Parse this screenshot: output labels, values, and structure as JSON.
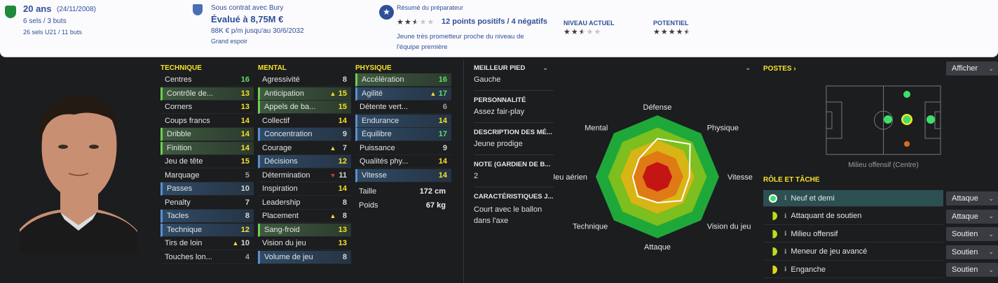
{
  "profile": {
    "age": "20 ans",
    "dob": "(24/11/2008)",
    "caps": "6 sels / 3 buts",
    "u21_caps": "26 sels U21 / 11 buts"
  },
  "contract": {
    "status": "Sous contrat avec Bury",
    "value": "Évalué à 8,75M €",
    "wage": "88K € p/m jusqu'au 30/6/2032",
    "tag": "Grand espoir"
  },
  "scout": {
    "title": "Résumé du préparateur",
    "points": "12 points positifs / 4 négatifs",
    "rating": 2.5,
    "summary_line1": "Jeune très prometteur proche du niveau de",
    "summary_line2": "l'équipe première"
  },
  "ability": {
    "current_label": "NIVEAU ACTUEL",
    "current_stars": 2.5,
    "potential_label": "POTENTIEL",
    "potential_stars": 4.5
  },
  "technique": {
    "header": "TECHNIQUE",
    "rows": [
      {
        "name": "Centres",
        "value": "16",
        "color": "g",
        "hl": ""
      },
      {
        "name": "Contrôle de...",
        "value": "13",
        "color": "y",
        "hl": "g"
      },
      {
        "name": "Corners",
        "value": "13",
        "color": "y",
        "hl": ""
      },
      {
        "name": "Coups francs",
        "value": "14",
        "color": "y",
        "hl": ""
      },
      {
        "name": "Dribble",
        "value": "14",
        "color": "y",
        "hl": "g"
      },
      {
        "name": "Finition",
        "value": "14",
        "color": "y",
        "hl": "g"
      },
      {
        "name": "Jeu de tête",
        "value": "15",
        "color": "y",
        "hl": ""
      },
      {
        "name": "Marquage",
        "value": "5",
        "color": "gr",
        "hl": ""
      },
      {
        "name": "Passes",
        "value": "10",
        "color": "w",
        "hl": "b"
      },
      {
        "name": "Penalty",
        "value": "7",
        "color": "w",
        "hl": ""
      },
      {
        "name": "Tacles",
        "value": "8",
        "color": "w",
        "hl": "b"
      },
      {
        "name": "Technique",
        "value": "12",
        "color": "y",
        "hl": "b"
      },
      {
        "name": "Tirs de loin",
        "value": "10",
        "color": "w",
        "hl": "",
        "tri": "up"
      },
      {
        "name": "Touches lon...",
        "value": "4",
        "color": "gr",
        "hl": ""
      }
    ]
  },
  "mental": {
    "header": "MENTAL",
    "rows": [
      {
        "name": "Agressivité",
        "value": "8",
        "color": "w",
        "hl": ""
      },
      {
        "name": "Anticipation",
        "value": "15",
        "color": "y",
        "hl": "g",
        "tri": "up"
      },
      {
        "name": "Appels de ba...",
        "value": "15",
        "color": "y",
        "hl": "g"
      },
      {
        "name": "Collectif",
        "value": "14",
        "color": "y",
        "hl": ""
      },
      {
        "name": "Concentration",
        "value": "9",
        "color": "w",
        "hl": "b"
      },
      {
        "name": "Courage",
        "value": "7",
        "color": "w",
        "hl": "",
        "tri": "up"
      },
      {
        "name": "Décisions",
        "value": "12",
        "color": "y",
        "hl": "b"
      },
      {
        "name": "Détermination",
        "value": "11",
        "color": "w",
        "hl": "",
        "tri": "down"
      },
      {
        "name": "Inspiration",
        "value": "14",
        "color": "y",
        "hl": ""
      },
      {
        "name": "Leadership",
        "value": "8",
        "color": "w",
        "hl": ""
      },
      {
        "name": "Placement",
        "value": "8",
        "color": "w",
        "hl": "",
        "tri": "up"
      },
      {
        "name": "Sang-froid",
        "value": "13",
        "color": "y",
        "hl": "g"
      },
      {
        "name": "Vision du jeu",
        "value": "13",
        "color": "y",
        "hl": ""
      },
      {
        "name": "Volume de jeu",
        "value": "8",
        "color": "w",
        "hl": "b"
      }
    ]
  },
  "physique": {
    "header": "PHYSIQUE",
    "rows": [
      {
        "name": "Accélération",
        "value": "16",
        "color": "g",
        "hl": "g"
      },
      {
        "name": "Agilité",
        "value": "17",
        "color": "g",
        "hl": "b",
        "tri": "up"
      },
      {
        "name": "Détente vert...",
        "value": "6",
        "color": "gr",
        "hl": ""
      },
      {
        "name": "Endurance",
        "value": "14",
        "color": "y",
        "hl": "b"
      },
      {
        "name": "Équilibre",
        "value": "17",
        "color": "g",
        "hl": "b"
      },
      {
        "name": "Puissance",
        "value": "9",
        "color": "w",
        "hl": ""
      },
      {
        "name": "Qualités phy...",
        "value": "14",
        "color": "y",
        "hl": ""
      },
      {
        "name": "Vitesse",
        "value": "14",
        "color": "y",
        "hl": "b"
      }
    ],
    "height_label": "Taille",
    "height": "172 cm",
    "weight_label": "Poids",
    "weight": "67 kg"
  },
  "info": {
    "foot_label": "MEILLEUR PIED",
    "foot": "Gauche",
    "personality_label": "PERSONNALITÉ",
    "personality": "Assez fair-play",
    "description_label": "DESCRIPTION DES MÉ...",
    "description": "Jeune prodige",
    "note_label": "NOTE (GARDIEN DE B...",
    "note": "2",
    "traits_label": "CARACTÉRISTIQUES J...",
    "traits_line1": "Court avec le ballon",
    "traits_line2": "dans l'axe"
  },
  "radar": {
    "labels": [
      "Défense",
      "Physique",
      "Vitesse",
      "Vision du jeu",
      "Attaque",
      "Technique",
      "Jeu aérien",
      "Mental"
    ],
    "values": [
      0.62,
      0.75,
      0.52,
      0.55,
      0.42,
      0.45,
      0.4,
      0.42
    ]
  },
  "positions": {
    "title": "POSTES",
    "show_button": "Afficher",
    "position_name": "Milieu offensif (Centre)",
    "roles_title": "RÔLE ET TÂCHE",
    "roles": [
      {
        "name": "Neuf et demi",
        "duty": "Attaque",
        "dot": "#3ee06a",
        "active": true
      },
      {
        "name": "Attaquant de soutien",
        "duty": "Attaque",
        "dot": "half",
        "active": false
      },
      {
        "name": "Milieu offensif",
        "duty": "Soutien",
        "dot": "half",
        "active": false
      },
      {
        "name": "Meneur de jeu avancé",
        "duty": "Soutien",
        "dot": "half",
        "active": false
      },
      {
        "name": "Enganche",
        "duty": "Soutien",
        "dot": "half2",
        "active": false
      }
    ]
  },
  "colors": {
    "accent": "#f6e22b",
    "good": "#5fe068",
    "blue": "#2f4f9a"
  }
}
